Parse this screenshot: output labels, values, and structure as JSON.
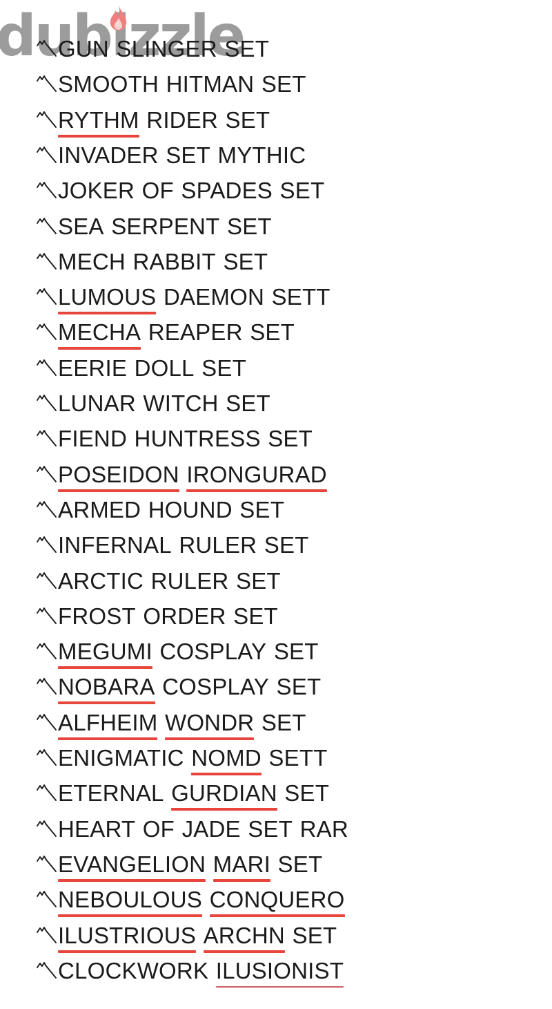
{
  "watermark": {
    "brand": "dubizzle",
    "icon": "flame-icon",
    "text_color": "#9c9c9c",
    "flame_color": "#ef8080"
  },
  "style": {
    "text_color": "#1b1b1b",
    "spellcheck_underline_color": "#e8453d",
    "background": "#ffffff"
  },
  "list": {
    "bullet_icon": "mountain-zigzag-bullet-icon",
    "item_count": 27,
    "items": [
      {
        "text": "GUN SLINGER SET",
        "words": [
          {
            "t": "GUN",
            "m": false
          },
          {
            "t": "SLINGER",
            "m": false
          },
          {
            "t": "SET",
            "m": false
          }
        ]
      },
      {
        "text": "SMOOTH HITMAN SET",
        "words": [
          {
            "t": "SMOOTH",
            "m": false
          },
          {
            "t": "HITMAN",
            "m": false
          },
          {
            "t": "SET",
            "m": false
          }
        ]
      },
      {
        "text": "RYTHM RIDER SET",
        "words": [
          {
            "t": "RYTHM",
            "m": true
          },
          {
            "t": "RIDER",
            "m": false
          },
          {
            "t": "SET",
            "m": false
          }
        ]
      },
      {
        "text": "INVADER SET MYTHIC",
        "words": [
          {
            "t": "INVADER",
            "m": false
          },
          {
            "t": "SET",
            "m": false
          },
          {
            "t": "MYTHIC",
            "m": false
          }
        ]
      },
      {
        "text": "JOKER OF SPADES SET",
        "words": [
          {
            "t": "JOKER",
            "m": false
          },
          {
            "t": "OF",
            "m": false
          },
          {
            "t": "SPADES",
            "m": false
          },
          {
            "t": "SET",
            "m": false
          }
        ]
      },
      {
        "text": "SEA SERPENT SET",
        "words": [
          {
            "t": "SEA",
            "m": false
          },
          {
            "t": "SERPENT",
            "m": false
          },
          {
            "t": "SET",
            "m": false
          }
        ]
      },
      {
        "text": "MECH RABBIT SET",
        "words": [
          {
            "t": "MECH",
            "m": false
          },
          {
            "t": "RABBIT",
            "m": false
          },
          {
            "t": "SET",
            "m": false
          }
        ]
      },
      {
        "text": "LUMOUS DAEMON SETT",
        "words": [
          {
            "t": "LUMOUS",
            "m": true
          },
          {
            "t": "DAEMON",
            "m": false
          },
          {
            "t": "SETT",
            "m": false
          }
        ]
      },
      {
        "text": "MECHA REAPER SET",
        "words": [
          {
            "t": "MECHA",
            "m": true
          },
          {
            "t": "REAPER",
            "m": false
          },
          {
            "t": "SET",
            "m": false
          }
        ]
      },
      {
        "text": "EERIE DOLL SET",
        "words": [
          {
            "t": "EERIE",
            "m": false
          },
          {
            "t": "DOLL",
            "m": false
          },
          {
            "t": "SET",
            "m": false
          }
        ]
      },
      {
        "text": "LUNAR WITCH SET",
        "words": [
          {
            "t": "LUNAR",
            "m": false
          },
          {
            "t": "WITCH",
            "m": false
          },
          {
            "t": "SET",
            "m": false
          }
        ]
      },
      {
        "text": "FIEND HUNTRESS SET",
        "words": [
          {
            "t": "FIEND",
            "m": false
          },
          {
            "t": "HUNTRESS",
            "m": false
          },
          {
            "t": "SET",
            "m": false
          }
        ]
      },
      {
        "text": "POSEIDON IRONGURAD",
        "words": [
          {
            "t": "POSEIDON",
            "m": true
          },
          {
            "t": "IRONGURAD",
            "m": true
          }
        ]
      },
      {
        "text": "ARMED HOUND SET",
        "words": [
          {
            "t": "ARMED",
            "m": false
          },
          {
            "t": "HOUND",
            "m": false
          },
          {
            "t": "SET",
            "m": false
          }
        ]
      },
      {
        "text": "INFERNAL RULER SET",
        "words": [
          {
            "t": "INFERNAL",
            "m": false
          },
          {
            "t": "RULER",
            "m": false
          },
          {
            "t": "SET",
            "m": false
          }
        ]
      },
      {
        "text": "ARCTIC RULER SET",
        "words": [
          {
            "t": "ARCTIC",
            "m": false
          },
          {
            "t": "RULER",
            "m": false
          },
          {
            "t": "SET",
            "m": false
          }
        ]
      },
      {
        "text": "FROST ORDER SET",
        "words": [
          {
            "t": "FROST",
            "m": false
          },
          {
            "t": "ORDER",
            "m": false
          },
          {
            "t": "SET",
            "m": false
          }
        ]
      },
      {
        "text": "MEGUMI COSPLAY SET",
        "words": [
          {
            "t": "MEGUMI",
            "m": true
          },
          {
            "t": "COSPLAY",
            "m": false
          },
          {
            "t": "SET",
            "m": false
          }
        ]
      },
      {
        "text": "NOBARA COSPLAY SET",
        "words": [
          {
            "t": "NOBARA",
            "m": true
          },
          {
            "t": "COSPLAY",
            "m": false
          },
          {
            "t": "SET",
            "m": false
          }
        ]
      },
      {
        "text": "ALFHEIM WONDR SET",
        "words": [
          {
            "t": "ALFHEIM",
            "m": true
          },
          {
            "t": "WONDR",
            "m": true
          },
          {
            "t": "SET",
            "m": false
          }
        ]
      },
      {
        "text": "ENIGMATIC NOMD SETT",
        "words": [
          {
            "t": "ENIGMATIC",
            "m": false
          },
          {
            "t": "NOMD",
            "m": true
          },
          {
            "t": "SETT",
            "m": false
          }
        ]
      },
      {
        "text": "ETERNAL GURDIAN SET",
        "words": [
          {
            "t": "ETERNAL",
            "m": false
          },
          {
            "t": "GURDIAN",
            "m": true
          },
          {
            "t": "SET",
            "m": false
          }
        ]
      },
      {
        "text": "HEART OF JADE SET RAR",
        "words": [
          {
            "t": "HEART",
            "m": false
          },
          {
            "t": "OF",
            "m": false
          },
          {
            "t": "JADE",
            "m": false
          },
          {
            "t": "SET",
            "m": false
          },
          {
            "t": "RAR",
            "m": false
          }
        ]
      },
      {
        "text": "EVANGELION MARI SET",
        "words": [
          {
            "t": "EVANGELION",
            "m": true
          },
          {
            "t": "MARI",
            "m": true
          },
          {
            "t": "SET",
            "m": false
          }
        ]
      },
      {
        "text": "NEBOULOUS CONQUERO",
        "words": [
          {
            "t": "NEBOULOUS",
            "m": true
          },
          {
            "t": "CONQUERO",
            "m": true
          }
        ]
      },
      {
        "text": "ILUSTRIOUS ARCHN SET",
        "words": [
          {
            "t": "ILUSTRIOUS",
            "m": true
          },
          {
            "t": "ARCHN",
            "m": true
          },
          {
            "t": "SET",
            "m": false
          }
        ]
      },
      {
        "text": "CLOCKWORK ILUSIONIST",
        "words": [
          {
            "t": "CLOCKWORK",
            "m": false
          },
          {
            "t": "ILUSIONIST",
            "m": true,
            "thin": true
          }
        ]
      }
    ]
  }
}
